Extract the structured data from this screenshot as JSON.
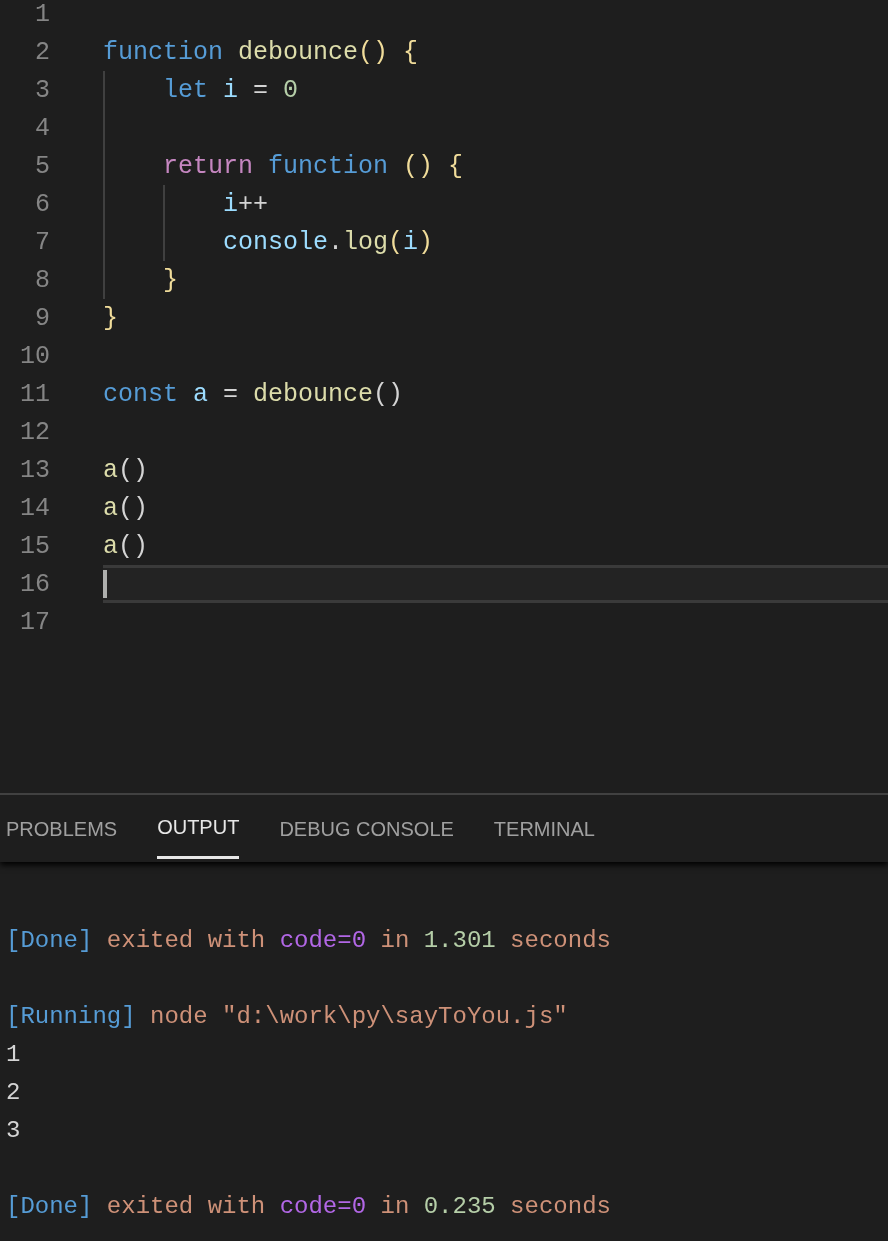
{
  "editor": {
    "lines": [
      {
        "number": "1",
        "active": false
      },
      {
        "number": "2",
        "active": false,
        "tokens": [
          {
            "text": "function",
            "kind": "keyword"
          },
          {
            "text": " debounce",
            "kind": "func"
          },
          {
            "text": "() {",
            "kind": "bracket"
          }
        ]
      },
      {
        "number": "3",
        "active": false,
        "tokens": [
          {
            "text": "    let",
            "kind": "keyword"
          },
          {
            "text": " i",
            "kind": "var"
          },
          {
            "text": " =",
            "kind": "plain"
          },
          {
            "text": " 0",
            "kind": "num"
          }
        ]
      },
      {
        "number": "4",
        "active": false
      },
      {
        "number": "5",
        "active": false,
        "tokens": [
          {
            "text": "    return",
            "kind": "control"
          },
          {
            "text": " function",
            "kind": "keyword"
          },
          {
            "text": " () {",
            "kind": "bracket"
          }
        ]
      },
      {
        "number": "6",
        "active": false,
        "tokens": [
          {
            "text": "        i",
            "kind": "var"
          },
          {
            "text": "++",
            "kind": "plain"
          }
        ]
      },
      {
        "number": "7",
        "active": false,
        "tokens": [
          {
            "text": "        console",
            "kind": "var"
          },
          {
            "text": ".",
            "kind": "plain"
          },
          {
            "text": "log",
            "kind": "func"
          },
          {
            "text": "(",
            "kind": "bracket"
          },
          {
            "text": "i",
            "kind": "var"
          },
          {
            "text": ")",
            "kind": "bracket"
          }
        ]
      },
      {
        "number": "8",
        "active": false,
        "tokens": [
          {
            "text": "    }",
            "kind": "bracket"
          }
        ]
      },
      {
        "number": "9",
        "active": false,
        "tokens": [
          {
            "text": "}",
            "kind": "bracket"
          }
        ]
      },
      {
        "number": "10",
        "active": false
      },
      {
        "number": "11",
        "active": false,
        "tokens": [
          {
            "text": "const",
            "kind": "keyword"
          },
          {
            "text": " a",
            "kind": "var"
          },
          {
            "text": " =",
            "kind": "plain"
          },
          {
            "text": " debounce",
            "kind": "func"
          },
          {
            "text": "()",
            "kind": "plain"
          }
        ]
      },
      {
        "number": "12",
        "active": false
      },
      {
        "number": "13",
        "active": false,
        "tokens": [
          {
            "text": "a",
            "kind": "func"
          },
          {
            "text": "()",
            "kind": "plain"
          }
        ]
      },
      {
        "number": "14",
        "active": false,
        "tokens": [
          {
            "text": "a",
            "kind": "func"
          },
          {
            "text": "()",
            "kind": "plain"
          }
        ]
      },
      {
        "number": "15",
        "active": false,
        "tokens": [
          {
            "text": "a",
            "kind": "func"
          },
          {
            "text": "()",
            "kind": "plain"
          }
        ]
      },
      {
        "number": "16",
        "active": true
      },
      {
        "number": "17",
        "active": false
      }
    ]
  },
  "panel": {
    "tabs": [
      {
        "label": "PROBLEMS",
        "selected": false
      },
      {
        "label": "OUTPUT",
        "selected": true
      },
      {
        "label": "DEBUG CONSOLE",
        "selected": false
      },
      {
        "label": "TERMINAL",
        "selected": false
      }
    ],
    "output": [
      {
        "lines": [
          {
            "tokens": [
              {
                "text": "[Done]",
                "kind": "tag"
              },
              {
                "text": " exited with",
                "kind": "string"
              },
              {
                "text": " code=0",
                "kind": "code"
              },
              {
                "text": " in",
                "kind": "string"
              },
              {
                "text": " 1.301",
                "kind": "num"
              },
              {
                "text": " seconds",
                "kind": "string"
              }
            ]
          }
        ]
      },
      {
        "lines": [
          {
            "tokens": [
              {
                "text": "[Running]",
                "kind": "tag"
              },
              {
                "text": " node \"d:\\work\\py\\sayToYou.js\"",
                "kind": "string"
              }
            ]
          },
          {
            "tokens": [
              {
                "text": "1",
                "kind": "plain"
              }
            ]
          },
          {
            "tokens": [
              {
                "text": "2",
                "kind": "plain"
              }
            ]
          },
          {
            "tokens": [
              {
                "text": "3",
                "kind": "plain"
              }
            ]
          }
        ]
      },
      {
        "lines": [
          {
            "tokens": [
              {
                "text": "[Done]",
                "kind": "tag"
              },
              {
                "text": " exited with",
                "kind": "string"
              },
              {
                "text": " code=0",
                "kind": "code"
              },
              {
                "text": " in",
                "kind": "string"
              },
              {
                "text": " 0.235",
                "kind": "num"
              },
              {
                "text": " seconds",
                "kind": "string"
              }
            ]
          }
        ]
      }
    ]
  }
}
